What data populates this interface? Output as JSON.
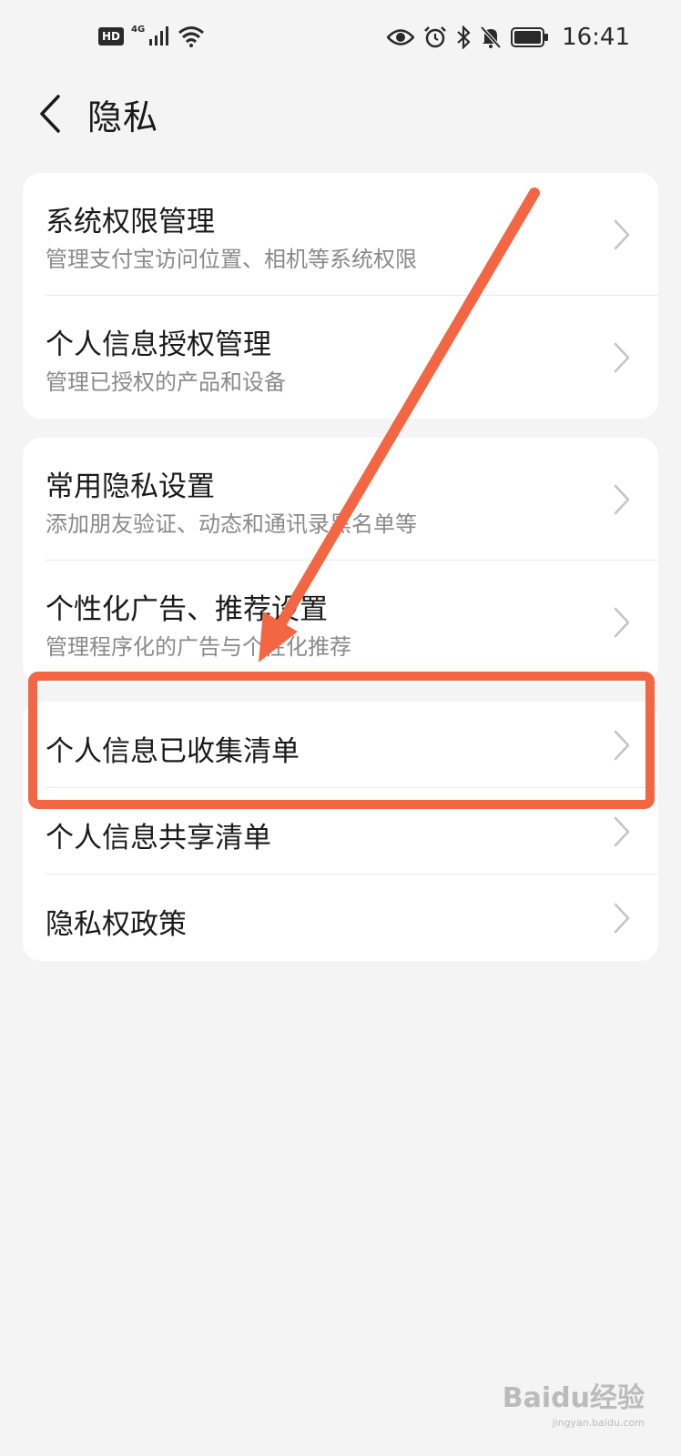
{
  "status_bar": {
    "hd": "HD",
    "network": "4G",
    "time": "16:41",
    "icons": [
      "hd-icon",
      "signal-icon",
      "wifi-icon",
      "eye-icon",
      "alarm-icon",
      "bluetooth-icon",
      "mute-icon",
      "battery-icon"
    ]
  },
  "header": {
    "back_icon": "chevron-left-icon",
    "title": "隐私"
  },
  "groups": [
    {
      "items": [
        {
          "title": "系统权限管理",
          "subtitle": "管理支付宝访问位置、相机等系统权限"
        },
        {
          "title": "个人信息授权管理",
          "subtitle": "管理已授权的产品和设备"
        }
      ]
    },
    {
      "items": [
        {
          "title": "常用隐私设置",
          "subtitle": "添加朋友验证、动态和通讯录黑名单等"
        },
        {
          "title": "个性化广告、推荐设置",
          "subtitle": "管理程序化的广告与个性化推荐"
        }
      ]
    },
    {
      "items": [
        {
          "title": "个人信息已收集清单"
        },
        {
          "title": "个人信息共享清单"
        },
        {
          "title": "隐私权政策"
        }
      ]
    }
  ],
  "annotation": {
    "color": "#f26644",
    "highlighted_item": "个人信息已收集清单"
  },
  "watermark": {
    "brand": "Baidu经验",
    "url": "jingyan.baidu.com"
  },
  "colors": {
    "background": "#f4f4f4",
    "card": "#ffffff",
    "primary_text": "#1a1a1a",
    "secondary_text": "#8a8a8a",
    "chevron": "#c4c4c4"
  }
}
